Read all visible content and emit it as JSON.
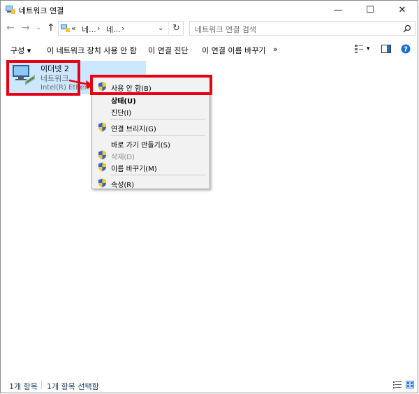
{
  "window": {
    "title": "네트워크 연결"
  },
  "caption": {
    "minimize": "—",
    "maximize": "☐",
    "close": "✕"
  },
  "nav": {
    "back": "←",
    "forward": "→",
    "recent": "⌄",
    "up": "↑"
  },
  "address": {
    "overflow": "«",
    "seg1": "네...",
    "sep1": "›",
    "seg2": "네...",
    "sep2": "›",
    "dropdown": "⌄",
    "refresh": "↻"
  },
  "search": {
    "placeholder": "네트워크 연결 검색"
  },
  "commands": {
    "organize": "구성 ▾",
    "disable": "이 네트워크 장치 사용 안 함",
    "diagnose": "이 연결 진단",
    "rename": "이 연결 이름 바꾸기",
    "more": "»",
    "view_dropdown": "▾"
  },
  "item": {
    "name": "이더넷 2",
    "type": "네트워크",
    "adapter": "Intel(R) Ethernet"
  },
  "context_menu": {
    "items": [
      {
        "label": "사용 안 함(B)"
      },
      {
        "label": "상태(U)"
      },
      {
        "label": "진단(I)"
      },
      {
        "label": "연결 브리지(G)"
      },
      {
        "label": "바로 가기 만들기(S)"
      },
      {
        "label": "삭제(D)"
      },
      {
        "label": "이름 바꾸기(M)"
      },
      {
        "label": "속성(R)"
      }
    ]
  },
  "status": {
    "count": "1개 항목",
    "selected": "1개 항목 선택함"
  },
  "colors": {
    "highlight": "#e60012",
    "selection": "#cce8ff",
    "menu_bg": "#f2f2f2",
    "help": "#1a6fc9"
  }
}
